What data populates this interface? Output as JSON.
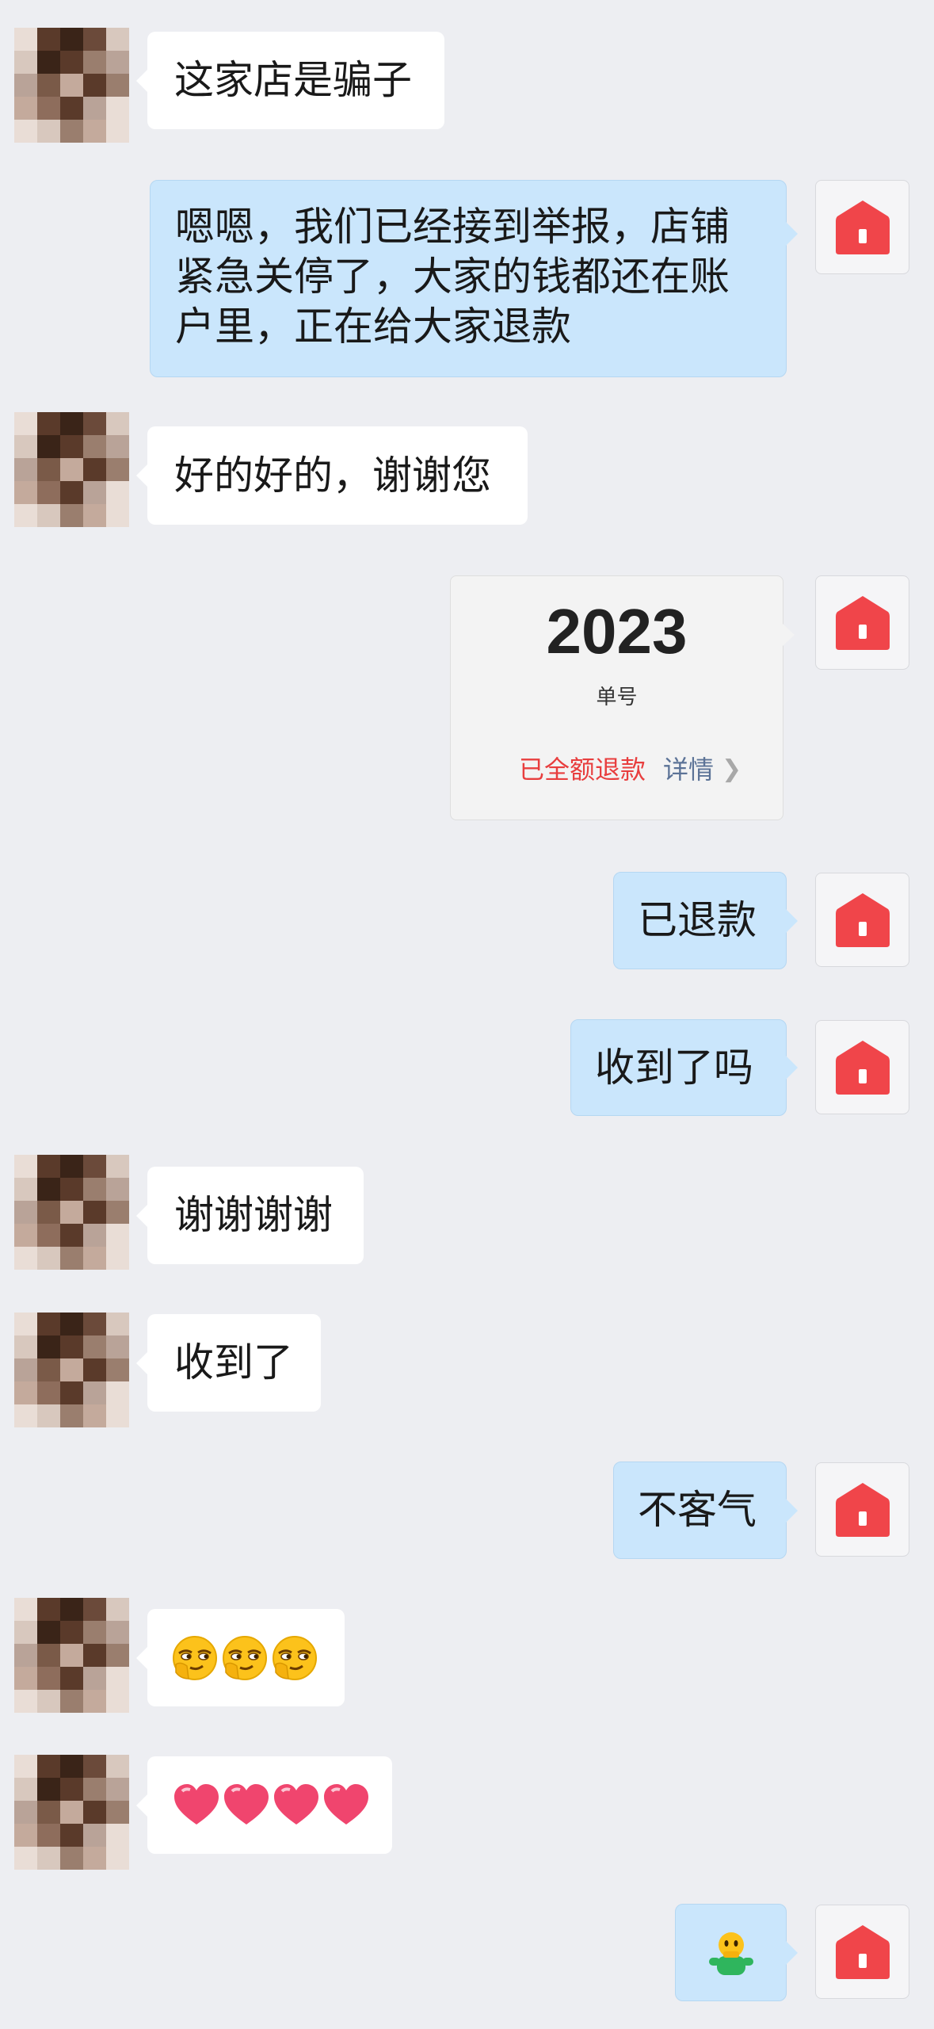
{
  "messages": [
    {
      "text": "这家店是骗子"
    },
    {
      "lines": [
        "嗯嗯，我们已经接到举报，店铺",
        "紧急关停了，大家的钱都还在账",
        "户里，正在给大家退款"
      ]
    },
    {
      "text": "好的好的，谢谢您"
    },
    {
      "order_card": {
        "number": "2023",
        "label": "单号",
        "status": "已全额退款",
        "detail": "详情"
      }
    },
    {
      "text": "已退款"
    },
    {
      "text": "收到了吗"
    },
    {
      "text": "谢谢谢谢"
    },
    {
      "text": "收到了"
    },
    {
      "text": "不客气"
    },
    {
      "emojis": [
        "smirk-emoji",
        "smirk-emoji",
        "smirk-emoji"
      ]
    },
    {
      "emojis": [
        "heart-emoji",
        "heart-emoji",
        "heart-emoji",
        "heart-emoji"
      ]
    },
    {
      "emojis": [
        "hugging-figure-emoji"
      ]
    }
  ],
  "colors": {
    "background": "#edeef2",
    "incoming_bubble": "#ffffff",
    "outgoing_bubble": "#cae6fc",
    "shop_icon": "#f0454a",
    "refund_status": "#e83e3e",
    "detail_link": "#5c7397"
  }
}
